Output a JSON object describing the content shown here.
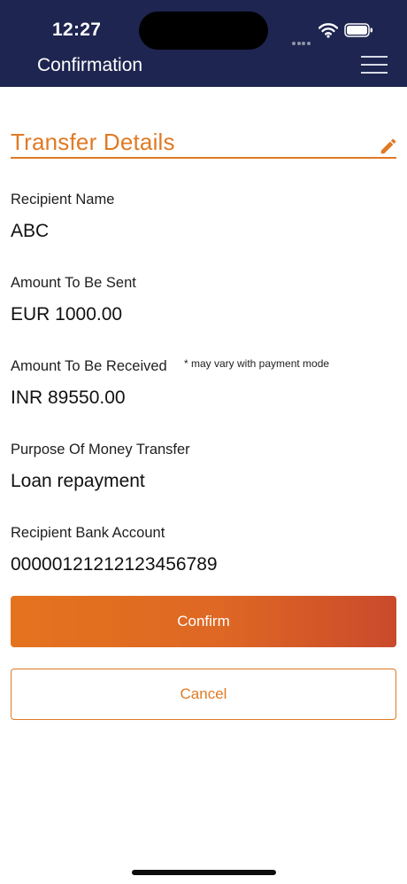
{
  "status_bar": {
    "time": "12:27"
  },
  "header": {
    "title": "Confirmation"
  },
  "section": {
    "title": "Transfer Details"
  },
  "fields": [
    {
      "label": "Recipient Name",
      "value": "ABC"
    },
    {
      "label": "Amount To Be Sent",
      "value": "EUR 1000.00"
    },
    {
      "label": "Amount To Be Received",
      "value": "INR 89550.00",
      "note": "* may vary with payment mode"
    },
    {
      "label": "Purpose Of Money Transfer",
      "value": "Loan repayment"
    },
    {
      "label": "Recipient Bank Account",
      "value": "00000121212123456789"
    }
  ],
  "actions": {
    "confirm_label": "Confirm",
    "cancel_label": "Cancel"
  },
  "colors": {
    "header_bg": "#1e2550",
    "accent": "#e07a24",
    "button_gradient_end": "#c94a2b"
  },
  "icons": [
    "wifi-icon",
    "battery-icon",
    "menu-icon",
    "edit-pencil-icon"
  ]
}
